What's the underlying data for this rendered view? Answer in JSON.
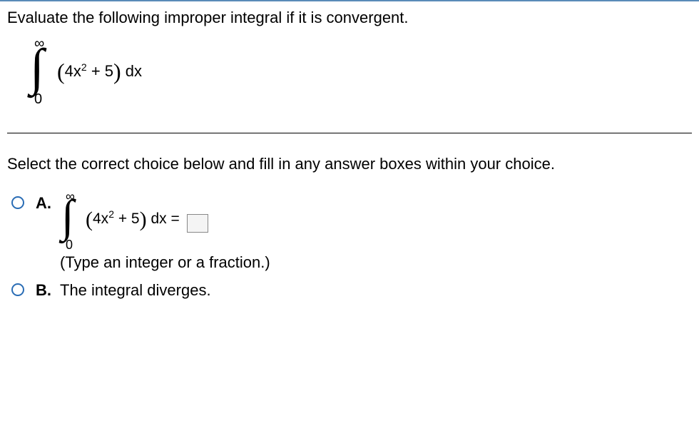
{
  "question": {
    "prompt": "Evaluate the following improper integral if it is convergent.",
    "integral": {
      "upper": "∞",
      "lower": "0",
      "expr_pre": "4x",
      "expr_exp": "2",
      "expr_post": " + 5",
      "dx": " dx"
    }
  },
  "instruction": "Select the correct choice below and fill in any answer boxes within your choice.",
  "choices": {
    "a": {
      "letter": "A.",
      "integral": {
        "upper": "∞",
        "lower": "0",
        "expr_pre": "4x",
        "expr_exp": "2",
        "expr_post": " + 5",
        "dx": " dx ="
      },
      "hint": "(Type an integer or a fraction.)"
    },
    "b": {
      "letter": "B.",
      "text": "The integral diverges."
    }
  }
}
